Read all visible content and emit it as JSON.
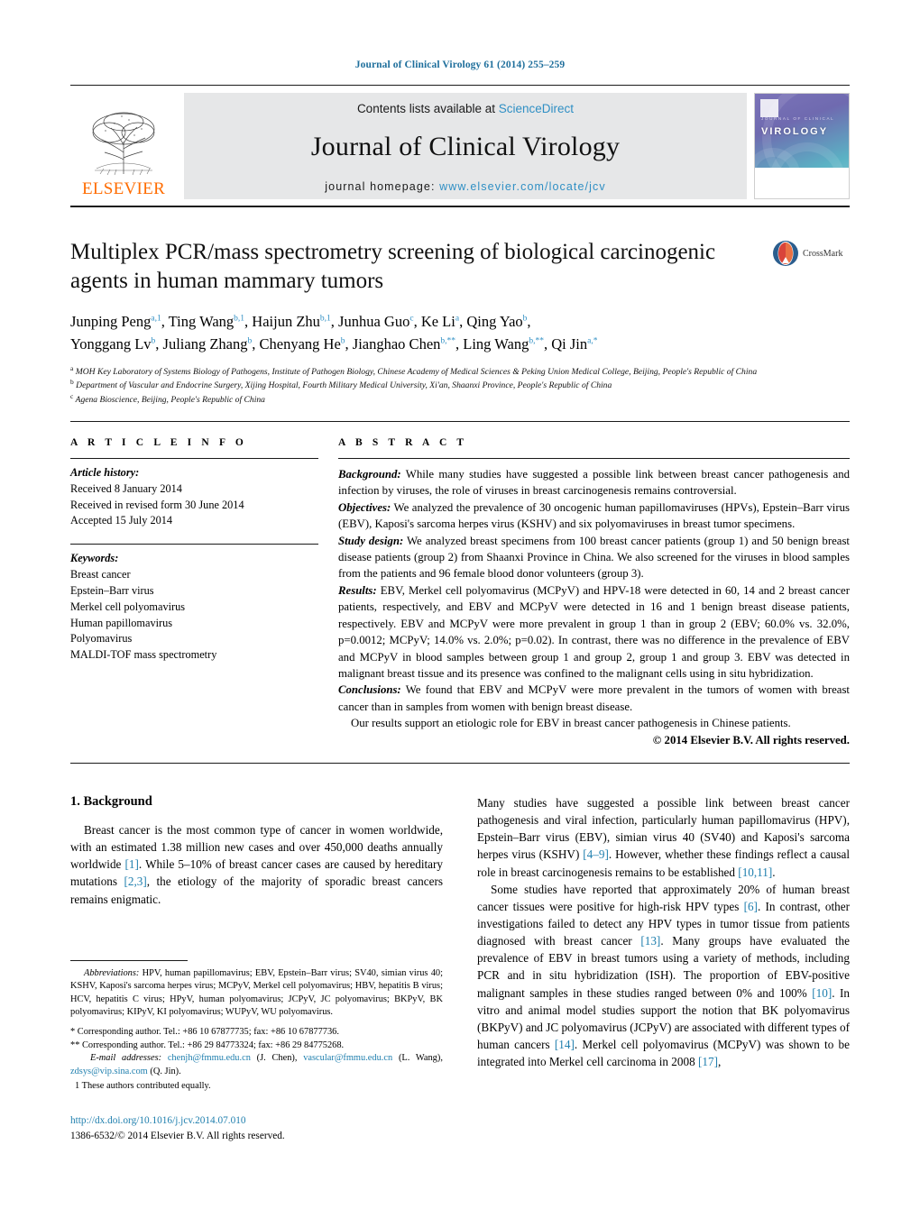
{
  "running_head": "Journal of Clinical Virology 61 (2014) 255–259",
  "banner": {
    "contents_prefix": "Contents lists available at ",
    "sciencedirect": "ScienceDirect",
    "journal_title": "Journal of Clinical Virology",
    "homepage_prefix": "journal homepage: ",
    "homepage_url": "www.elsevier.com/locate/jcv",
    "publisher_logo_text": "ELSEVIER",
    "cover_title": "VIROLOGY",
    "cover_subtitle": "JOURNAL OF CLINICAL",
    "sciencedirect_color": "#2f8fc4"
  },
  "article": {
    "title": "Multiplex PCR/mass spectrometry screening of biological carcinogenic agents in human mammary tumors",
    "crossmark_label": "CrossMark",
    "authors_line1": "Junping Peng a,1, Ting Wang b,1, Haijun Zhu b,1, Junhua Guo c, Ke Li a, Qing Yao b,",
    "authors_line2": "Yonggang Lv b, Juliang Zhang b, Chenyang He b, Jianghao Chen b,**, Ling Wang b,**, Qi Jin a,*",
    "authors": [
      {
        "name": "Junping Peng",
        "sup": "a,1"
      },
      {
        "name": "Ting Wang",
        "sup": "b,1"
      },
      {
        "name": "Haijun Zhu",
        "sup": "b,1"
      },
      {
        "name": "Junhua Guo",
        "sup": "c"
      },
      {
        "name": "Ke Li",
        "sup": "a"
      },
      {
        "name": "Qing Yao",
        "sup": "b"
      },
      {
        "name": "Yonggang Lv",
        "sup": "b"
      },
      {
        "name": "Juliang Zhang",
        "sup": "b"
      },
      {
        "name": "Chenyang He",
        "sup": "b"
      },
      {
        "name": "Jianghao Chen",
        "sup": "b,**"
      },
      {
        "name": "Ling Wang",
        "sup": "b,**"
      },
      {
        "name": "Qi Jin",
        "sup": "a,*"
      }
    ],
    "affiliations": [
      {
        "marker": "a",
        "text": "MOH Key Laboratory of Systems Biology of Pathogens, Institute of Pathogen Biology, Chinese Academy of Medical Sciences & Peking Union Medical College, Beijing, People's Republic of China"
      },
      {
        "marker": "b",
        "text": "Department of Vascular and Endocrine Surgery, Xijing Hospital, Fourth Military Medical University, Xi'an, Shaanxi Province, People's Republic of China"
      },
      {
        "marker": "c",
        "text": "Agena Bioscience, Beijing, People's Republic of China"
      }
    ]
  },
  "article_info": {
    "heading": "A R T I C L E   I N F O",
    "history_label": "Article history:",
    "history": [
      "Received 8 January 2014",
      "Received in revised form 30 June 2014",
      "Accepted 15 July 2014"
    ],
    "keywords_label": "Keywords:",
    "keywords": [
      "Breast cancer",
      "Epstein–Barr virus",
      "Merkel cell polyomavirus",
      "Human papillomavirus",
      "Polyomavirus",
      "MALDI-TOF mass spectrometry"
    ]
  },
  "abstract": {
    "heading": "A B S T R A C T",
    "sections": [
      {
        "label": "Background:",
        "text": " While many studies have suggested a possible link between breast cancer pathogenesis and infection by viruses, the role of viruses in breast carcinogenesis remains controversial."
      },
      {
        "label": "Objectives:",
        "text": " We analyzed the prevalence of 30 oncogenic human papillomaviruses (HPVs), Epstein–Barr virus (EBV), Kaposi's sarcoma herpes virus (KSHV) and six polyomaviruses in breast tumor specimens."
      },
      {
        "label": "Study design:",
        "text": " We analyzed breast specimens from 100 breast cancer patients (group 1) and 50 benign breast disease patients (group 2) from Shaanxi Province in China. We also screened for the viruses in blood samples from the patients and 96 female blood donor volunteers (group 3)."
      },
      {
        "label": "Results:",
        "text": " EBV, Merkel cell polyomavirus (MCPyV) and HPV-18 were detected in 60, 14 and 2 breast cancer patients, respectively, and EBV and MCPyV were detected in 16 and 1 benign breast disease patients, respectively. EBV and MCPyV were more prevalent in group 1 than in group 2 (EBV; 60.0% vs. 32.0%, p=0.0012; MCPyV; 14.0% vs. 2.0%; p=0.02). In contrast, there was no difference in the prevalence of EBV and MCPyV in blood samples between group 1 and group 2, group 1 and group 3. EBV was detected in malignant breast tissue and its presence was confined to the malignant cells using in situ hybridization."
      },
      {
        "label": "Conclusions:",
        "text": " We found that EBV and MCPyV were more prevalent in the tumors of women with breast cancer than in samples from women with benign breast disease."
      }
    ],
    "closing": "Our results support an etiologic role for EBV in breast cancer pathogenesis in Chinese patients.",
    "copyright": "© 2014 Elsevier B.V. All rights reserved."
  },
  "body": {
    "section_heading": "1. Background",
    "left_paragraphs": [
      "Breast cancer is the most common type of cancer in women worldwide, with an estimated 1.38 million new cases and over 450,000 deaths annually worldwide [1]. While 5–10% of breast cancer cases are caused by hereditary mutations [2,3], the etiology of the majority of sporadic breast cancers remains enigmatic."
    ],
    "right_paragraphs": [
      "Many studies have suggested a possible link between breast cancer pathogenesis and viral infection, particularly human papillomavirus (HPV), Epstein–Barr virus (EBV), simian virus 40 (SV40) and Kaposi's sarcoma herpes virus (KSHV) [4–9]. However, whether these findings reflect a causal role in breast carcinogenesis remains to be established [10,11].",
      "Some studies have reported that approximately 20% of human breast cancer tissues were positive for high-risk HPV types [6]. In contrast, other investigations failed to detect any HPV types in tumor tissue from patients diagnosed with breast cancer [13]. Many groups have evaluated the prevalence of EBV in breast tumors using a variety of methods, including PCR and in situ hybridization (ISH). The proportion of EBV-positive malignant samples in these studies ranged between 0% and 100% [10]. In vitro and animal model studies support the notion that BK polyomavirus (BKPyV) and JC polyomavirus (JCPyV) are associated with different types of human cancers [14]. Merkel cell polyomavirus (MCPyV) was shown to be integrated into Merkel cell carcinoma in 2008 [17],"
    ]
  },
  "footnotes": {
    "abbreviations_label": "Abbreviations:",
    "abbreviations_text": " HPV, human papillomavirus; EBV, Epstein–Barr virus; SV40, simian virus 40; KSHV, Kaposi's sarcoma herpes virus; MCPyV, Merkel cell polyomavirus; HBV, hepatitis B virus; HCV, hepatitis C virus; HPyV, human polyomavirus; JCPyV, JC polyomavirus; BKPyV, BK polyomavirus; KIPyV, KI polyomavirus; WUPyV, WU polyomavirus.",
    "corresponding_1": "* Corresponding author. Tel.: +86 10 67877735; fax: +86 10 67877736.",
    "corresponding_2": "** Corresponding author. Tel.: +86 29 84773324; fax: +86 29 84775268.",
    "email_label": "E-mail addresses:",
    "emails": [
      {
        "address": "chenjh@fmmu.edu.cn",
        "owner": "(J. Chen),"
      },
      {
        "address": "vascular@fmmu.edu.cn",
        "owner": "(L. Wang),"
      },
      {
        "address": "zdsys@vip.sina.com",
        "owner": "(Q. Jin)."
      }
    ],
    "equal_contrib": "1 These authors contributed equally."
  },
  "footer": {
    "doi": "http://dx.doi.org/10.1016/j.jcv.2014.07.010",
    "issn_line": "1386-6532/© 2014 Elsevier B.V. All rights reserved."
  }
}
